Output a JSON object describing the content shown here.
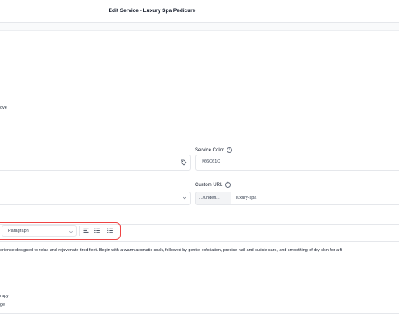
{
  "header": {
    "title": "Edit Service - Luxury Spa Pedicure"
  },
  "left_fragments": {
    "above_text": "ove",
    "item1": "rapy",
    "item2": "ge"
  },
  "service_color": {
    "label": "Service Color",
    "value": "#66C61C",
    "icon": "info-icon"
  },
  "custom_url": {
    "label": "Custom URL",
    "prefix": ".../undefi...",
    "value": "luxury-spa",
    "icon": "info-icon"
  },
  "editor": {
    "block_type": "Paragraph",
    "tools": [
      "align-left-icon",
      "bullet-list-icon",
      "numbered-list-icon"
    ],
    "content": "erience designed to relax and rejuvenate tired feet. Begin with a warm aromatic soak, followed by gentle exfoliation, precise nail and cuticle care, and smoothing of dry skin for a fi"
  },
  "colors": {
    "highlight": "#ef4444",
    "border": "#e5e7eb"
  }
}
